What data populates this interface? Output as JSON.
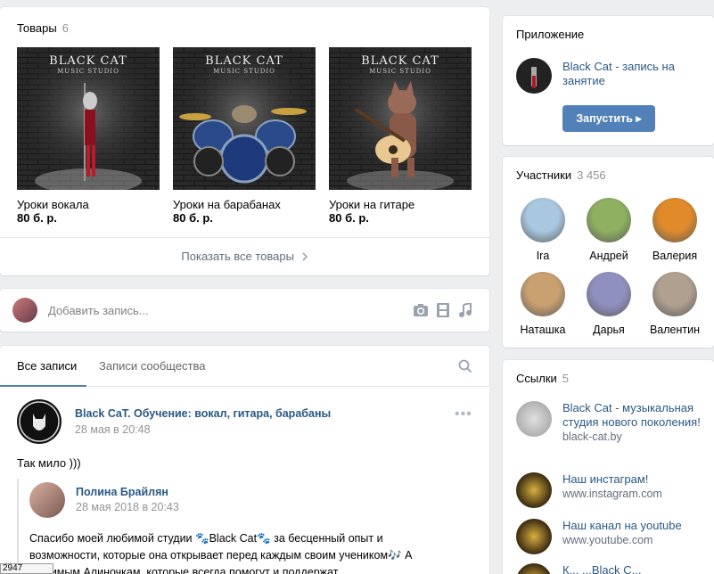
{
  "products": {
    "title": "Товары",
    "count": "6",
    "logo_line1": "BLACK CAT",
    "logo_line2": "MUSIC STUDIO",
    "items": [
      {
        "name": "Уроки вокала",
        "price": "80 б. р."
      },
      {
        "name": "Уроки на барабанах",
        "price": "80 б. р."
      },
      {
        "name": "Уроки на гитаре",
        "price": "80 б. р."
      }
    ],
    "show_all": "Показать все товары"
  },
  "add_post": {
    "placeholder": "Добавить запись..."
  },
  "posts": {
    "tabs": [
      {
        "label": "Все записи"
      },
      {
        "label": "Записи сообщества"
      }
    ],
    "post": {
      "author": "Black CaT. Обучение: вокал, гитара, барабаны",
      "time": "28 мая в 20:48",
      "text": "Так мило )))",
      "repost_author": "Полина Брайлян",
      "repost_time": "28 мая 2018 в 20:43",
      "repost_line1": "Спасибо моей любимой студии 🐾Black Cat🐾 за бесценный опыт и",
      "repost_line2": "возможности, которые она открывает перед каждым своим учеником🎶 А",
      "repost_line3": "любимым Алиночкам, которые всегда помогут и поддержат,"
    }
  },
  "app": {
    "title": "Приложение",
    "name": "Black Cat - запись на занятие",
    "button": "Запустить ▸"
  },
  "members": {
    "title": "Участники",
    "count": "3 456",
    "list": [
      {
        "name": "Ira",
        "color": "#a8c8e0"
      },
      {
        "name": "Андрей",
        "color": "#8fb060"
      },
      {
        "name": "Валерия",
        "color": "#e08a2a"
      },
      {
        "name": "Наташка",
        "color": "#c9a070"
      },
      {
        "name": "Дарья",
        "color": "#9090c0"
      },
      {
        "name": "Валентин",
        "color": "#b0a090"
      }
    ]
  },
  "links": {
    "title": "Ссылки",
    "count": "5",
    "items": [
      {
        "title": "Black Cat - музыкальная студия нового поколения!",
        "url": "black-cat.by"
      },
      {
        "title": "Наш инстаграм!",
        "url": "www.instagram.com"
      },
      {
        "title": "Наш канал на youtube",
        "url": "www.youtube.com"
      },
      {
        "title": "К... ...Black C...",
        "url": ""
      }
    ]
  },
  "status_bar": {
    "text": "2947"
  },
  "colors": {
    "accent": "#5181b8",
    "link": "#2a5885",
    "background": "#edeef0"
  }
}
